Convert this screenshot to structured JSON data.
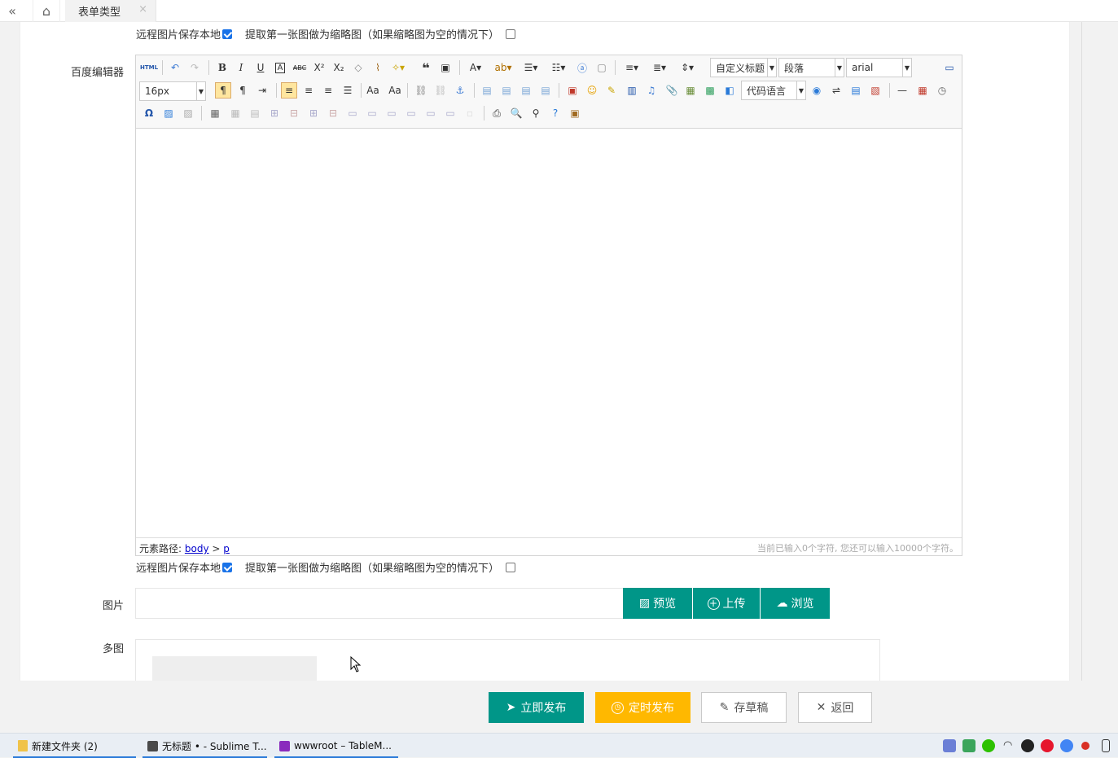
{
  "tabbar": {
    "active_tab": "表单类型"
  },
  "fields": {
    "editor_label": "百度编辑器",
    "image_label": "图片",
    "multi_label": "多图"
  },
  "options": {
    "remote_save": "远程图片保存本地",
    "thumbnail": "提取第一张图做为缩略图（如果缩略图为空的情况下）"
  },
  "editor": {
    "font_size": "16px",
    "heading_combo": "自定义标题",
    "paragraph_combo": "段落",
    "font_combo": "arial",
    "code_combo": "代码语言",
    "html_btn": "HTML",
    "path_prefix": "元素路径:",
    "path_body": "body",
    "path_sep": ">",
    "path_p": "p",
    "word_count": "当前已输入0个字符, 您还可以输入10000个字符。"
  },
  "image_buttons": {
    "preview": "预览",
    "upload": "上传",
    "browse": "浏览"
  },
  "actions": {
    "publish": "立即发布",
    "schedule": "定时发布",
    "draft": "存草稿",
    "back": "返回"
  },
  "colors": {
    "primary": "#009688",
    "warning": "#ffb800",
    "selected": "#1a73e8"
  },
  "taskbar": {
    "items": [
      "新建文件夹 (2)",
      "无标题 • - Sublime T...",
      "wwwroot – TableM..."
    ]
  }
}
